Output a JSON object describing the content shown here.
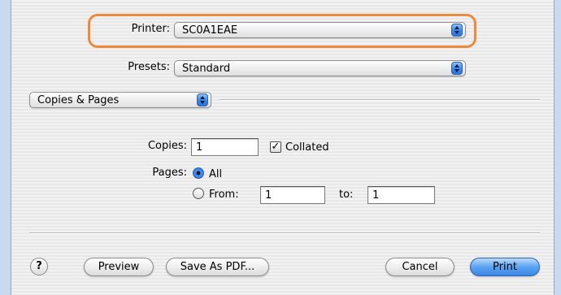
{
  "printer": {
    "label": "Printer:",
    "value": "SC0A1EAE"
  },
  "presets": {
    "label": "Presets:",
    "value": "Standard"
  },
  "section": {
    "value": "Copies & Pages"
  },
  "copies": {
    "label": "Copies:",
    "value": "1",
    "collated_label": "Collated",
    "collated_check": "✓"
  },
  "pages": {
    "label": "Pages:",
    "all_label": "All",
    "from_label": "From:",
    "from_value": "1",
    "to_label": "to:",
    "to_value": "1"
  },
  "buttons": {
    "help": "?",
    "preview": "Preview",
    "save_pdf": "Save As PDF...",
    "cancel": "Cancel",
    "print": "Print"
  },
  "colors": {
    "highlight": "#e98a3c",
    "accent": "#3b87e5"
  }
}
